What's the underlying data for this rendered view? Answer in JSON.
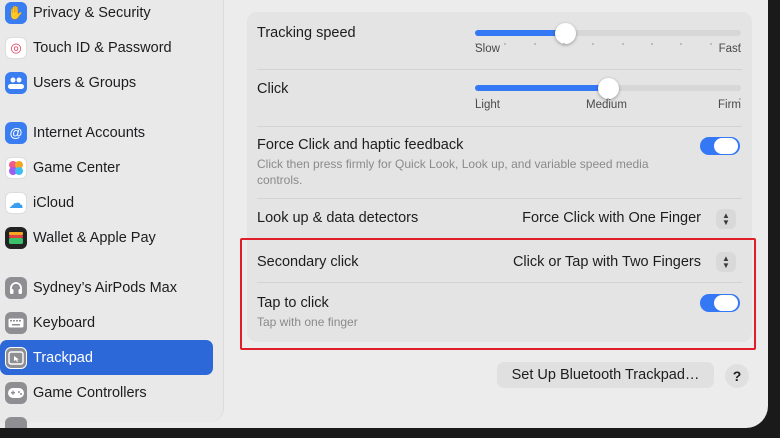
{
  "sidebar": {
    "items": [
      {
        "label": "Privacy & Security",
        "icon": "hand-icon",
        "color": "#3a7df0",
        "glyph": "✋"
      },
      {
        "label": "Touch ID & Password",
        "icon": "fingerprint-icon",
        "color": "#ffffff",
        "glyph": "◎"
      },
      {
        "label": "Users & Groups",
        "icon": "users-icon",
        "color": "#3a7df0",
        "glyph": "👥"
      },
      {
        "label": "Internet Accounts",
        "icon": "at-icon",
        "color": "#3a7df0",
        "glyph": "@"
      },
      {
        "label": "Game Center",
        "icon": "game-center-icon",
        "color": "#ffffff",
        "glyph": "●"
      },
      {
        "label": "iCloud",
        "icon": "cloud-icon",
        "color": "#ffffff",
        "glyph": "☁"
      },
      {
        "label": "Wallet & Apple Pay",
        "icon": "wallet-icon",
        "color": "#222222",
        "glyph": "▤"
      },
      {
        "label": "Sydney’s AirPods Max",
        "icon": "headphones-icon",
        "color": "#8e8e93",
        "glyph": "◠"
      },
      {
        "label": "Keyboard",
        "icon": "keyboard-icon",
        "color": "#8e8e93",
        "glyph": "⌨"
      },
      {
        "label": "Trackpad",
        "icon": "trackpad-icon",
        "color": "#8e8e93",
        "glyph": "▭"
      },
      {
        "label": "Game Controllers",
        "icon": "gamepad-icon",
        "color": "#8e8e93",
        "glyph": "✚"
      }
    ],
    "selected": "Trackpad"
  },
  "settings": {
    "tracking_speed": {
      "label": "Tracking speed",
      "min_label": "Slow",
      "max_label": "Fast",
      "value_fraction": 0.34
    },
    "click": {
      "label": "Click",
      "min_label": "Light",
      "mid_label": "Medium",
      "max_label": "Firm",
      "value_fraction": 0.5
    },
    "force_click": {
      "label": "Force Click and haptic feedback",
      "description": "Click then press firmly for Quick Look, Look up, and variable speed media controls.",
      "enabled": true
    },
    "look_up": {
      "label": "Look up & data detectors",
      "value": "Force Click with One Finger"
    },
    "secondary_click": {
      "label": "Secondary click",
      "value": "Click or Tap with Two Fingers"
    },
    "tap_to_click": {
      "label": "Tap to click",
      "description": "Tap with one finger",
      "enabled": true
    }
  },
  "footer": {
    "setup_button": "Set Up Bluetooth Trackpad…",
    "help_button": "?"
  },
  "colors": {
    "accent": "#3478f6",
    "highlight_box": "#e01e2a",
    "selected_sidebar": "#2c68d8"
  }
}
